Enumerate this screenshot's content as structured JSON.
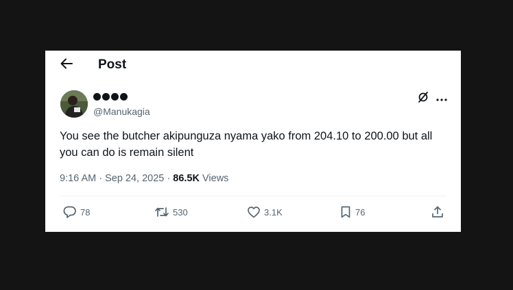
{
  "header": {
    "title": "Post"
  },
  "post": {
    "display_name_emoji": "●●●●",
    "handle": "@Manukagia",
    "text": "You see the butcher akipunguza nyama yako from 204.10 to 200.00 but all you can do is remain silent",
    "time": "9:16 AM",
    "separator": " · ",
    "date": "Sep 24, 2025",
    "views_count": "86.5K",
    "views_label": "Views"
  },
  "actions": {
    "replies": "78",
    "reposts": "530",
    "likes": "3.1K",
    "bookmarks": "76"
  },
  "icons": {
    "back": "arrow-left-icon",
    "grok": "grok-icon",
    "more": "more-horizontal-icon",
    "reply": "reply-icon",
    "repost": "repost-icon",
    "like": "heart-icon",
    "bookmark": "bookmark-icon",
    "share": "share-icon"
  },
  "colors": {
    "background": "#141414",
    "card": "#ffffff",
    "text_primary": "#0f1419",
    "text_secondary": "#536471"
  }
}
